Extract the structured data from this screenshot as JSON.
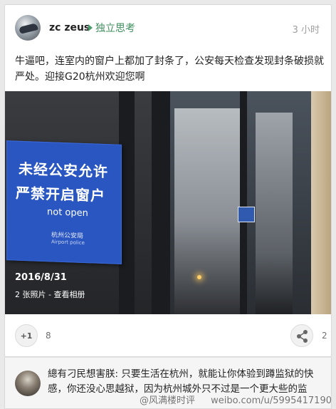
{
  "post": {
    "author": "zc zeus",
    "community": "独立思考",
    "time": "3 小时",
    "text": "牛逼吧，连室内的窗户上都加了封条了，公安每天检查发现封条破损就严处。迎接G20杭州欢迎您啊"
  },
  "photo": {
    "sign_line1": "未经公安允许",
    "sign_line2": "严禁开启窗户",
    "sign_line3": "not open",
    "sign_line4": "杭州公安局",
    "sign_line5": "Airport police",
    "date": "2016/8/31",
    "count_label": "2 张照片 - 查看相册"
  },
  "actions": {
    "plus_label": "+1",
    "plus_count": "8",
    "share_count": "2"
  },
  "comment": {
    "text": "總有刁民想害朕: 只要生活在杭州，就能让你体验到蹲监狱的快感，你还没心思越狱，因为杭州城外只不过是一个更大些的监"
  },
  "watermark": {
    "left": "@风满楼时评",
    "right": "weibo.com/u/5995417190"
  },
  "colors": {
    "community_green": "#3e8f5e",
    "sign_blue": "#2a56c1"
  },
  "icons": [
    "avatar-image",
    "arrow-right-icon",
    "share-icon"
  ]
}
